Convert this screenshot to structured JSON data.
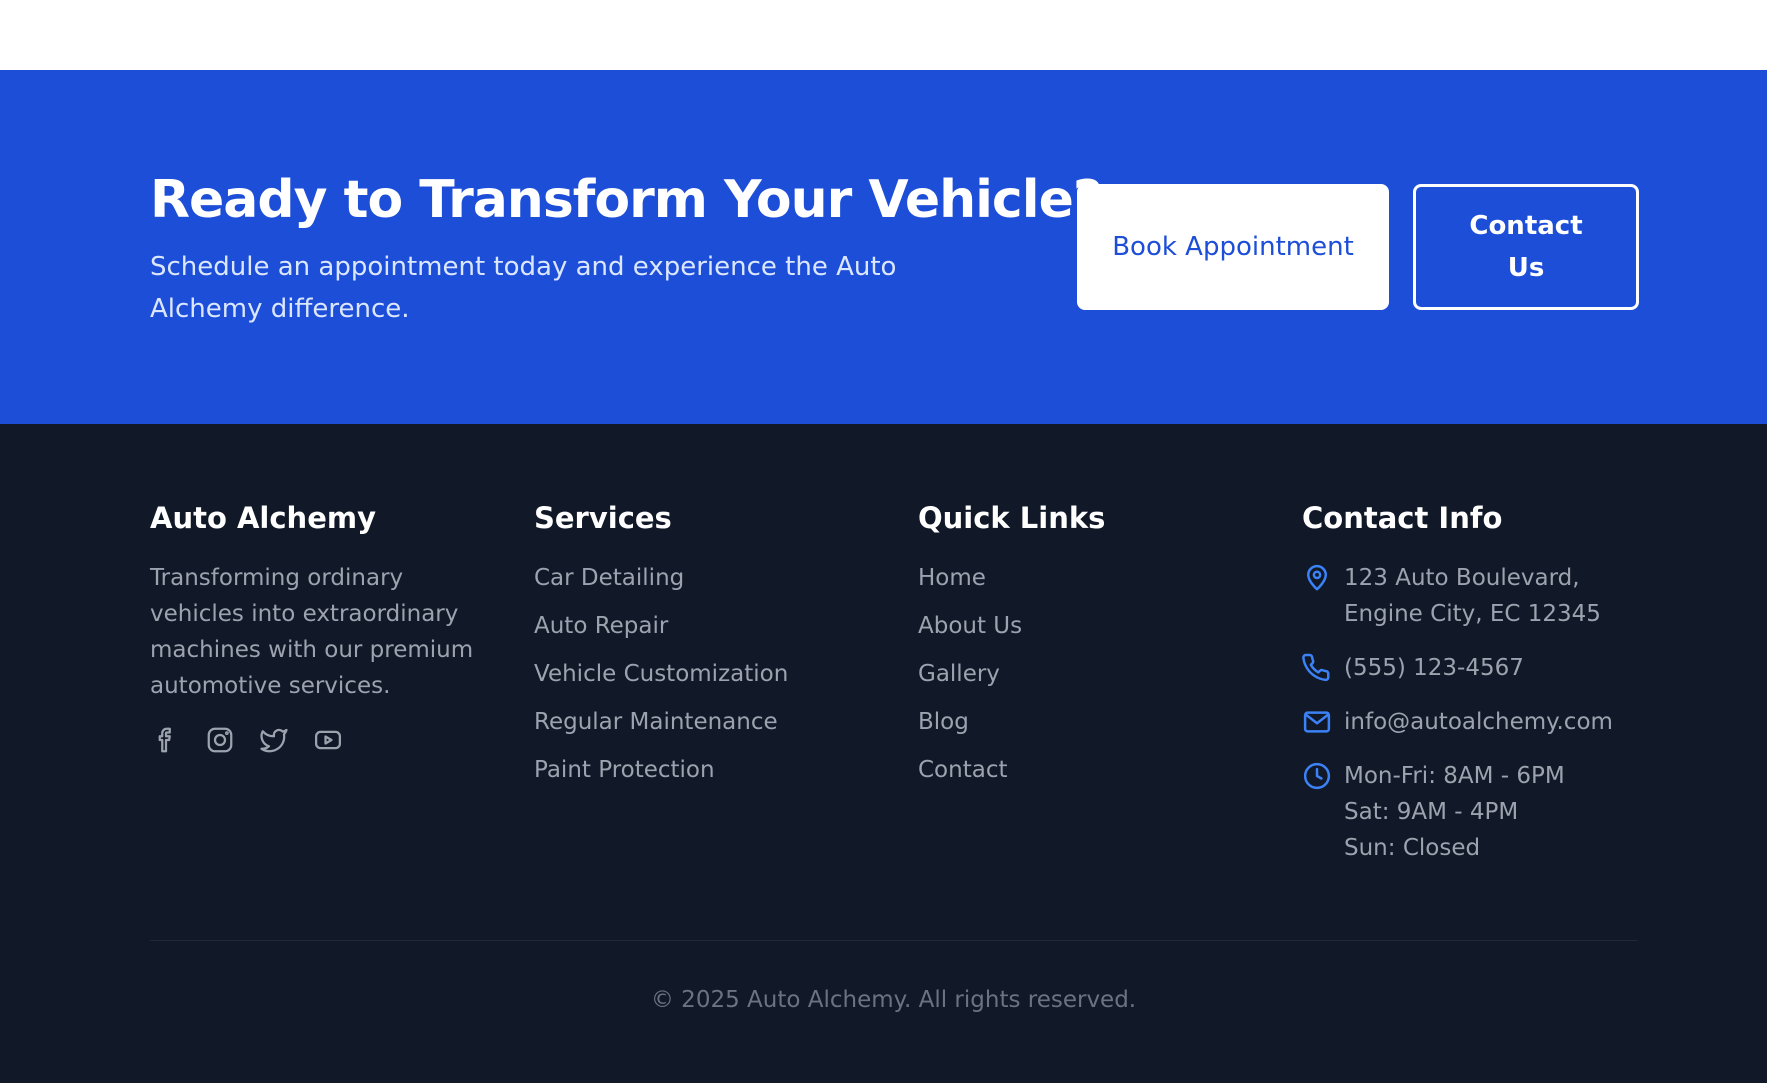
{
  "cta": {
    "title": "Ready to Transform Your Vehicle?",
    "subtitle": "Schedule an appointment today and experience the Auto Alchemy difference.",
    "book_label": "Book Appointment",
    "contact_label": "Contact Us"
  },
  "footer": {
    "brand": {
      "title": "Auto Alchemy",
      "description": "Transforming ordinary vehicles into extraordinary machines with our premium automotive services.",
      "socials": [
        "facebook-icon",
        "instagram-icon",
        "twitter-icon",
        "youtube-icon"
      ]
    },
    "services": {
      "title": "Services",
      "items": [
        "Car Detailing",
        "Auto Repair",
        "Vehicle Customization",
        "Regular Maintenance",
        "Paint Protection"
      ]
    },
    "quick_links": {
      "title": "Quick Links",
      "items": [
        "Home",
        "About Us",
        "Gallery",
        "Blog",
        "Contact"
      ]
    },
    "contact": {
      "title": "Contact Info",
      "address": "123 Auto Boulevard, Engine City, EC 12345",
      "phone": "(555) 123-4567",
      "email": "info@autoalchemy.com",
      "hours": [
        "Mon-Fri: 8AM - 6PM",
        "Sat: 9AM - 4PM",
        "Sun: Closed"
      ]
    },
    "copyright": "© 2025 Auto Alchemy. All rights reserved."
  },
  "colors": {
    "cta_background": "#1d4ed8",
    "footer_background": "#111827",
    "accent_icon": "#3b82f6",
    "muted_text": "#9ca3af"
  }
}
